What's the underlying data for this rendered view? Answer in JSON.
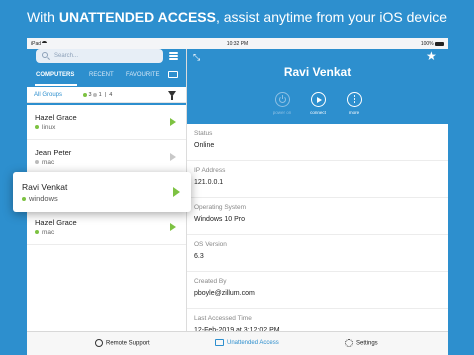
{
  "promo": {
    "prefix": "With ",
    "bold": "UNATTENDED ACCESS",
    "suffix": ", assist anytime from your iOS device"
  },
  "status_bar": {
    "left": "iPad",
    "time": "10:32 PM",
    "battery": "100%"
  },
  "sidebar": {
    "search_placeholder": "Search...",
    "tabs": [
      {
        "label": "COMPUTERS",
        "active": true
      },
      {
        "label": "RECENT",
        "active": false
      },
      {
        "label": "FAVOURITE",
        "active": false
      }
    ],
    "filter": {
      "groups_label": "All Groups",
      "online_count": "3",
      "offline_count": "1",
      "total_count": "4"
    },
    "computers": [
      {
        "name": "Hazel Grace",
        "os": "linux",
        "online": true
      },
      {
        "name": "Jean Peter",
        "os": "mac",
        "online": false
      },
      {
        "name": "Ravi Venkat",
        "os": "windows",
        "online": true
      },
      {
        "name": "Hazel Grace",
        "os": "mac",
        "online": true
      }
    ]
  },
  "detail": {
    "name": "Ravi Venkat",
    "actions": [
      {
        "label": "power on",
        "enabled": false,
        "icon": "power-icon"
      },
      {
        "label": "connect",
        "enabled": true,
        "icon": "play-icon"
      },
      {
        "label": "more",
        "enabled": true,
        "icon": "more-icon"
      }
    ],
    "fields": [
      {
        "key": "Status",
        "value": "Online"
      },
      {
        "key": "IP Address",
        "value": "121.0.0.1"
      },
      {
        "key": "Operating System",
        "value": "Windows 10 Pro"
      },
      {
        "key": "OS Version",
        "value": "6.3"
      },
      {
        "key": "Created By",
        "value": "pboyle@zillum.com"
      },
      {
        "key": "Last Accessed Time",
        "value": "12-Feb-2019 at 3:12:02 PM"
      }
    ]
  },
  "bottom_bar": [
    {
      "label": "Remote Support",
      "icon": "globe-icon",
      "active": false
    },
    {
      "label": "Unattended Access",
      "icon": "monitor-icon",
      "active": true
    },
    {
      "label": "Settings",
      "icon": "gear-icon",
      "active": false
    }
  ],
  "colors": {
    "brand_blue": "#2d8fce",
    "online_green": "#7dc242",
    "offline_gray": "#bbbbbb"
  }
}
